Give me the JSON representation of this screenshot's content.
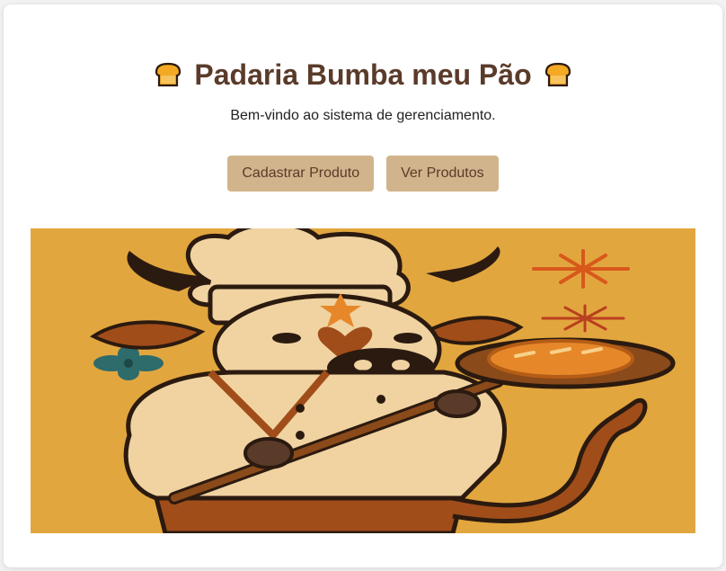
{
  "header": {
    "title": "Padaria Bumba meu Pão",
    "subtitle": "Bem-vindo ao sistema de gerenciamento."
  },
  "actions": {
    "register_label": "Cadastrar Produto",
    "view_label": "Ver Produtos"
  },
  "icons": {
    "title_left": "bread-icon",
    "title_right": "bread-icon"
  },
  "colors": {
    "title": "#5a3b2a",
    "button_bg": "#d2b48c",
    "button_text": "#5a3b2a",
    "hero_bg": "#e2a63e"
  },
  "hero": {
    "description_icon": "bull-baker-illustration"
  }
}
